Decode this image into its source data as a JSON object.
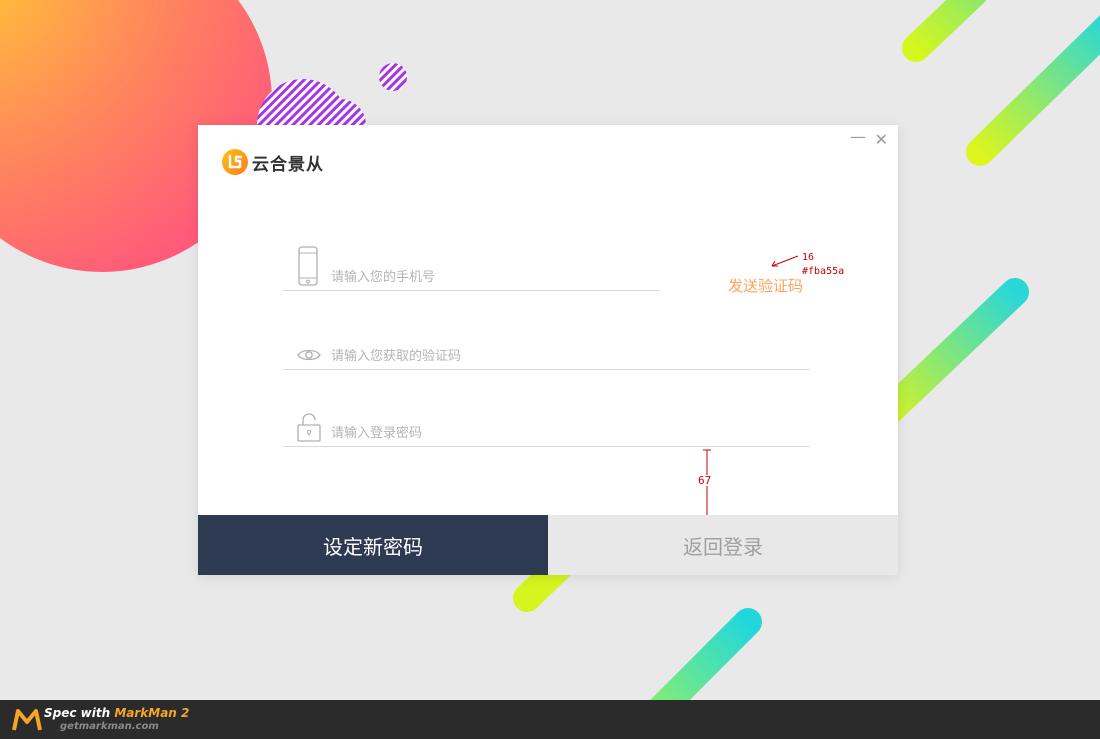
{
  "colors": {
    "background": "#e9e9e9",
    "primary_button": "#2d3a52",
    "secondary_button": "#e8e8e8",
    "link_accent": "#fba55a",
    "spec_annotation": "#cc0000"
  },
  "window": {
    "controls": {
      "minimize": "—",
      "close": "✕"
    }
  },
  "brand": {
    "name": "云合景从",
    "logo_icon": "brand-logo-icon"
  },
  "form": {
    "phone": {
      "placeholder": "请输入您的手机号",
      "icon": "phone-icon"
    },
    "send_code_label": "发送验证码",
    "code": {
      "placeholder": "请输入您获取的验证码",
      "icon": "eye-icon"
    },
    "password": {
      "placeholder": "请输入登录密码",
      "icon": "unlock-icon"
    }
  },
  "buttons": {
    "primary_label": "设定新密码",
    "secondary_label": "返回登录"
  },
  "annotations": {
    "font_size": "16",
    "color": "#fba55a",
    "spacing": "67"
  },
  "footer": {
    "title_prefix": "Spec with ",
    "title_accent": "MarkMan 2",
    "url": "getmarkman.com"
  }
}
